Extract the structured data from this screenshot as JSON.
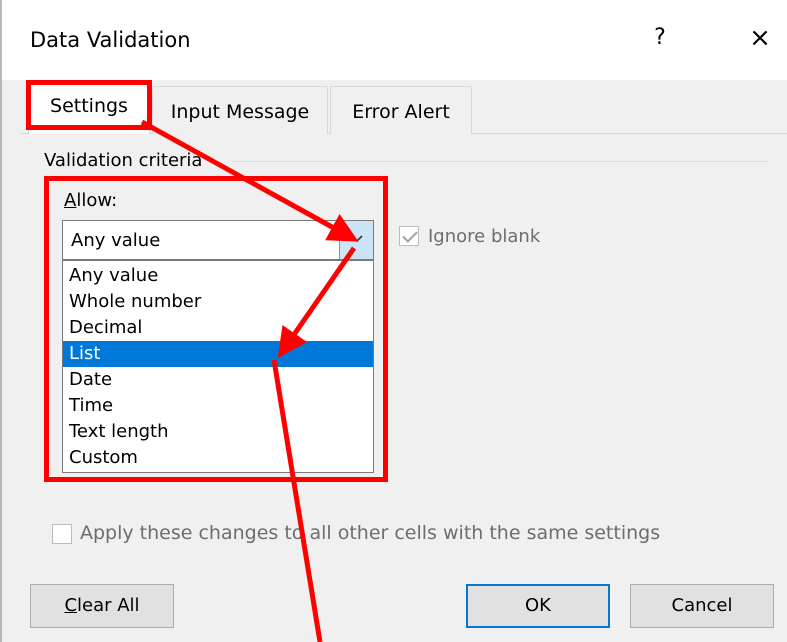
{
  "window": {
    "title": "Data Validation",
    "help_label": "?",
    "close_label": "×"
  },
  "tabs": [
    {
      "label": "Settings",
      "active": true
    },
    {
      "label": "Input Message",
      "active": false
    },
    {
      "label": "Error Alert",
      "active": false
    }
  ],
  "settings": {
    "group_label": "Validation criteria",
    "allow_label_prefix": "A",
    "allow_label_rest": "llow:",
    "allow_value": "Any value",
    "ignore_blank_label": "Ignore blank",
    "ignore_blank_checked": true,
    "allow_options": [
      "Any value",
      "Whole number",
      "Decimal",
      "List",
      "Date",
      "Time",
      "Text length",
      "Custom"
    ],
    "highlighted_option": "List",
    "apply_label": "Apply these changes to all other cells with the same settings",
    "apply_checked": false
  },
  "buttons": {
    "clear_all_prefix": "C",
    "clear_all_rest": "lear All",
    "ok": "OK",
    "cancel": "Cancel"
  },
  "colors": {
    "annotation": "#ff0000",
    "selection": "#0078d7",
    "dropdown_arrow_bg": "#cce4f7"
  },
  "icons": {
    "dropdown_arrow": "chevron-down-icon",
    "checkmark": "checkmark-icon"
  }
}
